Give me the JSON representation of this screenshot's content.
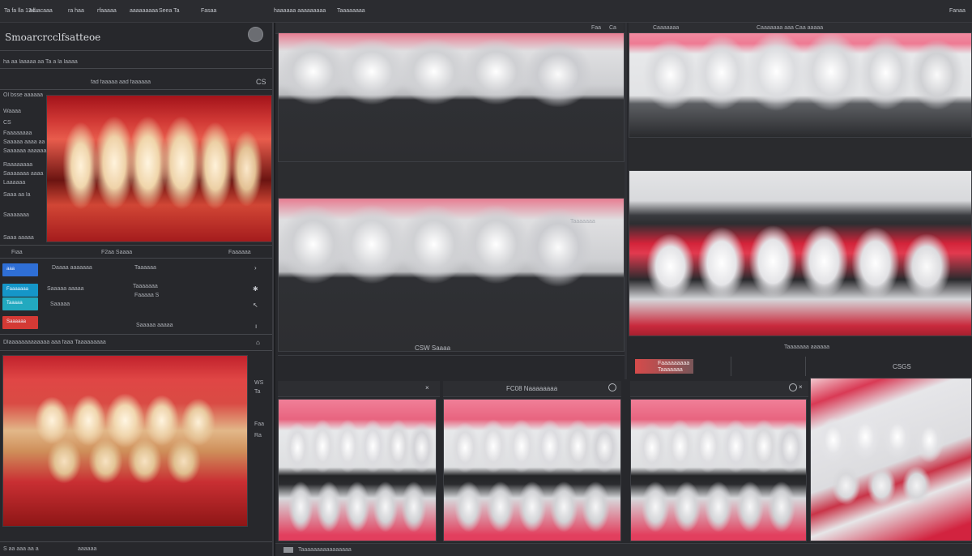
{
  "menubar": {
    "items": [
      "Ta  fa lla 13  lu",
      "ad  acaaa",
      "ra haa",
      "rfaaaaa",
      "aaaaaaaaa",
      "Seea  Ta",
      "Fasaa",
      "haaaaaa aaaaaaaaa",
      "Taaaaaaaa"
    ],
    "right_items": [
      "Fanaa"
    ]
  },
  "left_panel": {
    "title": "Smoarcrcclfsatteoe",
    "subtitle_row": "ha aa laaaaa aa Ta a la laaaa",
    "image1_header": "fad faaaaa aad faaaaaa",
    "image1_badge": "CS",
    "overlay_labels": [
      "Ol bsse aaaaaa",
      "Waaaa",
      "CS",
      "Faaaaaaaa",
      "Saaaaa aaaa aa",
      "Saaaaaa aaaaaa",
      "Raaaaaaaa",
      "Saaaaaaa aaaa",
      "Laaaaaa",
      "Saaa aa la",
      "Saaaaaaa",
      "Saaa aaaaa"
    ],
    "toolbar": {
      "label_a": "Fiaa",
      "label_b": "F2aa  Saaaa",
      "label_c": "Faaaaaa"
    },
    "buttons": [
      {
        "label": "aaa",
        "color": "#2f6fd6"
      },
      {
        "label": "Faaaaaaa",
        "color": "#1596c8"
      },
      {
        "label": "Taaaaa",
        "color": "#22a9bf"
      },
      {
        "label": "Saaaaaa",
        "color": "#d43a35"
      }
    ],
    "rows": [
      {
        "col1": "Daaaa aaaaaaa",
        "col2": "Taaaaaa",
        "icon": "chevron-icon"
      },
      {
        "col1": "Saaaaa aaaaa",
        "col2": "Taaaaaaa",
        "col3": "Faaaaa S",
        "icon": "gear-icon"
      },
      {
        "col1": "Saaaaa",
        "col2": "",
        "icon": "cursor-icon"
      },
      {
        "col1": "",
        "col2": "Saaaaa aaaaa",
        "icon": "info-icon"
      }
    ],
    "footer_label": "Dlaaaaaaaaaaaaa aaa faaa Taaaaaaaaa",
    "image2_labels": [
      "WS",
      "Ta",
      "Faa",
      "Ra"
    ],
    "status_bar": [
      "S aa  aaa  aa a",
      "aaaaaa"
    ]
  },
  "workspace": {
    "top_header_left": [
      "Faa",
      "Ca"
    ],
    "top_header_right": [
      "Caaaaaaa",
      "Caaaaaaa aaa  Caa  aaaaa"
    ],
    "center_caption": "CSW Saaaa",
    "right_caption": "Taaaaaaa aaaaaa",
    "chips": [
      "Faaaaaaaaa",
      "Taaaaaaa"
    ],
    "bottom_header_center": "FC08  Naaaaaaaa",
    "bottom_header_right": "CSGS",
    "status_bar_label": "Taaaaaaaaaaaaaaaa"
  }
}
